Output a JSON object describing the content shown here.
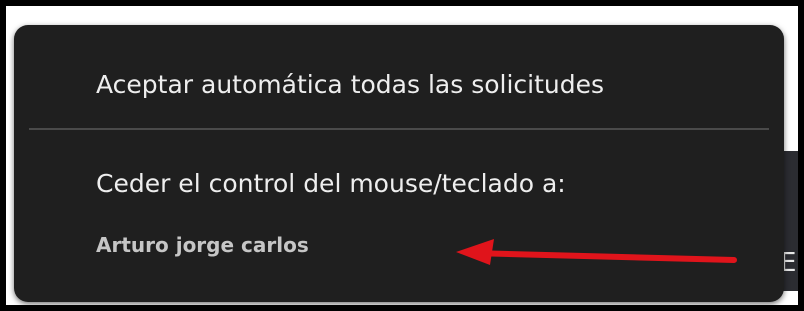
{
  "menu": {
    "accept_all_label": "Aceptar automática todas las solicitudes",
    "give_control_label": "Ceder el control del mouse/teclado a:",
    "participants": [
      "Arturo jorge carlos"
    ]
  },
  "background": {
    "partial_text": "E"
  },
  "annotation": {
    "arrow_icon": "red-arrow-left",
    "arrow_color": "#e0141b"
  },
  "colors": {
    "popup_bg": "#1f1f1f",
    "frame_border": "#000000",
    "divider": "#4a4a4a"
  }
}
